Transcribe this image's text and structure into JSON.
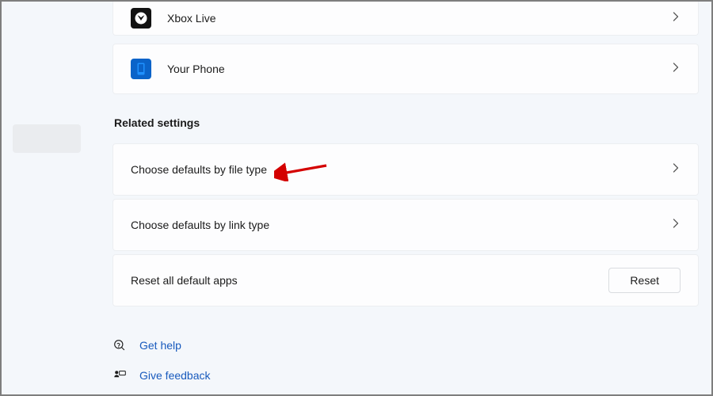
{
  "apps": [
    {
      "label": "Xbox Live",
      "icon": "xbox"
    },
    {
      "label": "Your Phone",
      "icon": "phone"
    }
  ],
  "related": {
    "heading": "Related settings",
    "items": [
      {
        "label": "Choose defaults by file type"
      },
      {
        "label": "Choose defaults by link type"
      }
    ],
    "reset": {
      "label": "Reset all default apps",
      "button": "Reset"
    }
  },
  "help": {
    "get_help": "Get help",
    "give_feedback": "Give feedback"
  }
}
